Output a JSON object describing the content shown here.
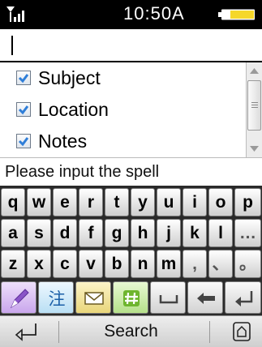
{
  "status": {
    "time": "10:50A",
    "signal_icon": "signal-strength-icon",
    "battery_icon": "battery-icon"
  },
  "input": {
    "value": ""
  },
  "options": {
    "items": [
      {
        "label": "Subject",
        "checked": true
      },
      {
        "label": "Location",
        "checked": true
      },
      {
        "label": "Notes",
        "checked": true
      }
    ]
  },
  "prompt": "Please input the spell",
  "keyboard": {
    "row1": [
      "q",
      "w",
      "e",
      "r",
      "t",
      "y",
      "u",
      "i",
      "o",
      "p"
    ],
    "row2": [
      "a",
      "s",
      "d",
      "f",
      "g",
      "h",
      "j",
      "k",
      "l",
      "…"
    ],
    "row3": [
      "z",
      "x",
      "c",
      "v",
      "b",
      "n",
      "m",
      ",",
      "、",
      "。"
    ],
    "function_row": [
      {
        "icon": "handwriting-pen-icon",
        "color": "#d8b8f0"
      },
      {
        "icon": "zhuyin-input-icon",
        "label": "注",
        "color": "#c9e7f7"
      },
      {
        "icon": "envelope-icon",
        "color": "#f3e6a0"
      },
      {
        "icon": "symbol-hash-icon",
        "color": "#cdeea8"
      },
      {
        "icon": "space-icon",
        "color": "#e6e6e6"
      },
      {
        "icon": "backspace-icon",
        "color": "#e6e6e6"
      },
      {
        "icon": "enter-icon",
        "color": "#e6e6e6"
      }
    ]
  },
  "softkeys": {
    "left_icon": "back-arrow-icon",
    "center_label": "Search",
    "right_icon": "home-icon"
  },
  "colors": {
    "status_bar": "#000000",
    "checkbox_check": "#2f7ed8",
    "battery_fill": "#f5d72a"
  }
}
